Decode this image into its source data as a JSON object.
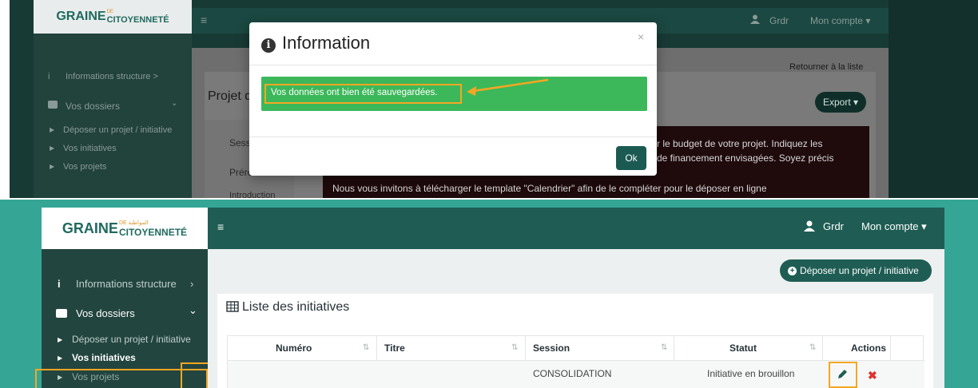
{
  "logo": {
    "text": "GRAINE",
    "sub_top": "DE",
    "sub_arabic": "المواطنة",
    "sub_main": "CITOYENNETÉ"
  },
  "top": {
    "navbar": {
      "menu_icon": "≡",
      "user": "Grdr",
      "account": "Mon compte ▾"
    },
    "back_link": "Retourner à la liste",
    "page_title_partial": "Projet d",
    "export_button": "Export ▾",
    "sidebar": {
      "info_label": "Informations structure  >",
      "dossiers_label": "Vos dossiers",
      "links": [
        "Déposer un projet / initiative",
        "Vos initiatives",
        "Vos projets"
      ]
    },
    "menu_items": [
      "Sess",
      "Prére",
      "Introduction"
    ],
    "dark_text_lines": [
      "r le budget de votre projet. Indiquez les",
      "de financement envisagées. Soyez précis"
    ],
    "bottom_line": "Nous vous invitons à télécharger le template \"Calendrier\" afin de le compléter pour le déposer en ligne",
    "modal": {
      "title": "Information",
      "close": "×",
      "message": "Vos données ont bien été sauvegardées.",
      "ok_button": "Ok",
      "highlight_color": "#f5a623",
      "alert_color": "#3cb85a"
    }
  },
  "bottom": {
    "navbar": {
      "menu_icon": "≡",
      "user": "Grdr",
      "account": "Mon compte ▾"
    },
    "deposit_button": "Déposer un projet / initiative",
    "list_title": "Liste des initiatives",
    "sidebar": {
      "info_label": "Informations structure",
      "dossiers_label": "Vos dossiers",
      "links": [
        "Déposer un projet / initiative",
        "Vos initiatives",
        "Vos projets"
      ]
    },
    "table": {
      "headers": [
        "Numéro",
        "Titre",
        "Session",
        "Statut",
        "Actions"
      ],
      "rows": [
        {
          "numero": "",
          "titre": "",
          "session": "CONSOLIDATION",
          "statut": "Initiative en brouillon"
        }
      ]
    },
    "colors": {
      "teal": "#35a596",
      "sidebar": "#23453f",
      "navbar": "#1f5d54",
      "delete": "#e0322d",
      "highlight": "#f5a623"
    }
  }
}
